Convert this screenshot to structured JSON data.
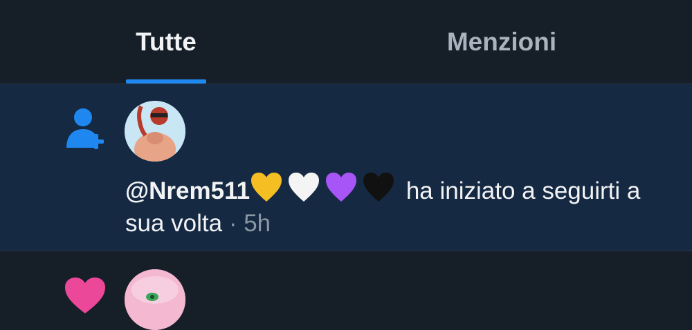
{
  "tabs": {
    "all_label": "Tutte",
    "mentions_label": "Menzioni",
    "active": "Tutte"
  },
  "notifications": [
    {
      "type": "follow",
      "icon": "person-add-icon",
      "username": "@Nrem511",
      "username_emojis": [
        "yellow-heart",
        "white-heart",
        "purple-heart",
        "black-heart"
      ],
      "action": "ha iniziato a seguirti a sua volta",
      "separator": "·",
      "time": "5h",
      "unread": true
    },
    {
      "type": "like",
      "icon": "heart-icon"
    }
  ],
  "colors": {
    "background": "#161e27",
    "unread_background": "#162942",
    "accent": "#1f88f0",
    "like": "#ec4899",
    "text_primary": "#f1f3f5",
    "text_secondary": "#8a97a5"
  }
}
